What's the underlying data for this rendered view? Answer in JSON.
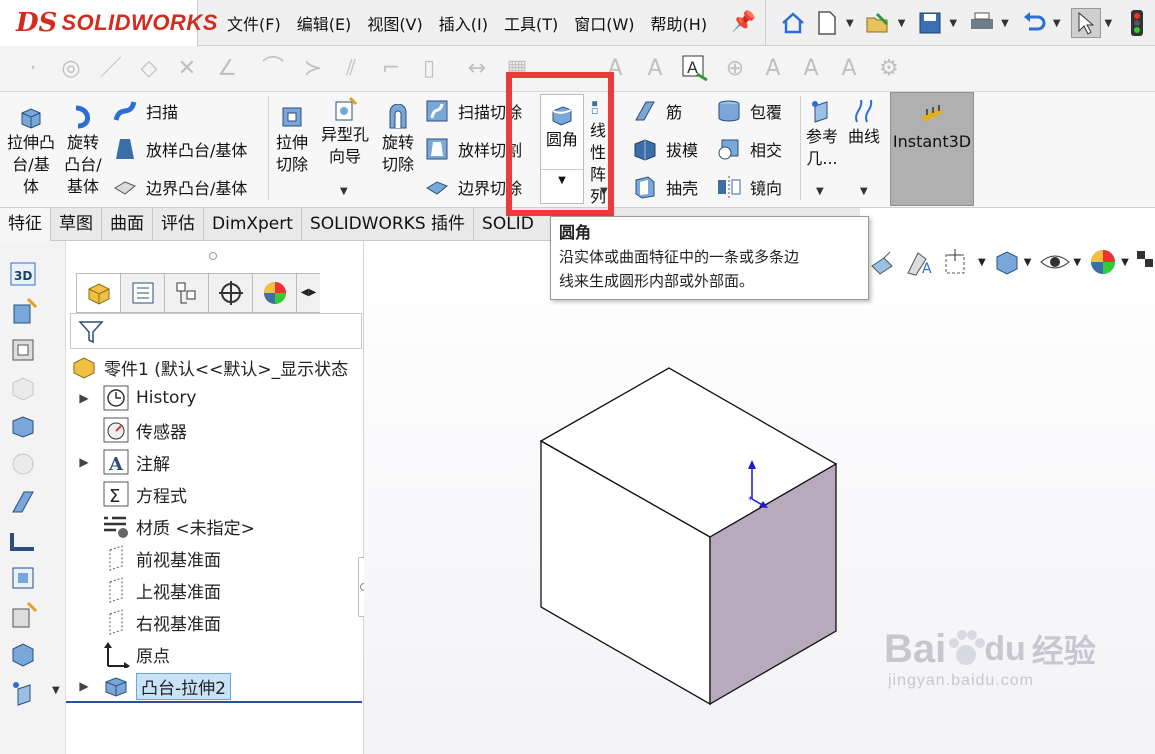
{
  "app": {
    "logo_mark": "DS",
    "brand": "SOLIDWORKS"
  },
  "menu": [
    "文件(F)",
    "编辑(E)",
    "视图(V)",
    "插入(I)",
    "工具(T)",
    "窗口(W)",
    "帮助(H)"
  ],
  "quick_access_icons": [
    "home-icon",
    "new-document-icon",
    "open-icon",
    "save-icon",
    "print-icon",
    "undo-icon",
    "select-icon",
    "traffic-light-icon"
  ],
  "ribbon": {
    "extrude_boss": "拉伸凸台/基体",
    "revolve_boss": "旋转凸台/基体",
    "sweep": "扫描",
    "loft_boss": "放样凸台/基体",
    "boundary_boss": "边界凸台/基体",
    "extrude_cut": "拉伸切除",
    "hole_wizard": "异型孔向导",
    "revolve_cut": "旋转切除",
    "sweep_cut": "扫描切除",
    "loft_cut": "放样切割",
    "boundary_cut": "边界切除",
    "fillet": "圆角",
    "linear_pattern": "线性阵列",
    "rib": "筋",
    "draft": "拔模",
    "shell": "抽壳",
    "wrap": "包覆",
    "intersect": "相交",
    "mirror": "镜向",
    "reference_geometry": "参考几...",
    "curves": "曲线",
    "instant3d": "Instant3D"
  },
  "tabs": [
    "特征",
    "草图",
    "曲面",
    "评估",
    "DimXpert",
    "SOLIDWORKS 插件",
    "SOLID"
  ],
  "tooltip": {
    "title": "圆角",
    "body_line1": "沿实体或曲面特征中的一条或多条边",
    "body_line2": "线来生成圆形内部或外部面。"
  },
  "tree": {
    "root": "零件1 (默认<<默认>_显示状态",
    "items": [
      {
        "label": "History",
        "icon": "history-icon",
        "expandable": true
      },
      {
        "label": "传感器",
        "icon": "sensor-icon",
        "expandable": false
      },
      {
        "label": "注解",
        "icon": "annotation-icon",
        "expandable": true
      },
      {
        "label": "方程式",
        "icon": "equation-icon",
        "expandable": false
      },
      {
        "label": "材质 <未指定>",
        "icon": "material-icon",
        "expandable": false
      },
      {
        "label": "前视基准面",
        "icon": "plane-icon",
        "expandable": false
      },
      {
        "label": "上视基准面",
        "icon": "plane-icon",
        "expandable": false
      },
      {
        "label": "右视基准面",
        "icon": "plane-icon",
        "expandable": false
      },
      {
        "label": "原点",
        "icon": "origin-icon",
        "expandable": false
      },
      {
        "label": "凸台-拉伸2",
        "icon": "extrude-feature-icon",
        "expandable": true,
        "selected": true
      }
    ]
  },
  "watermark": {
    "main": "Bai",
    "paw": "du",
    "cn": "经验",
    "url": "jingyan.baidu.com"
  },
  "colors": {
    "accent": "#2b6fd6",
    "highlight": "#ee3a3a",
    "brand": "#d52b1e",
    "side_face": "#b9a9bd",
    "selection": "#c8e2f7"
  }
}
